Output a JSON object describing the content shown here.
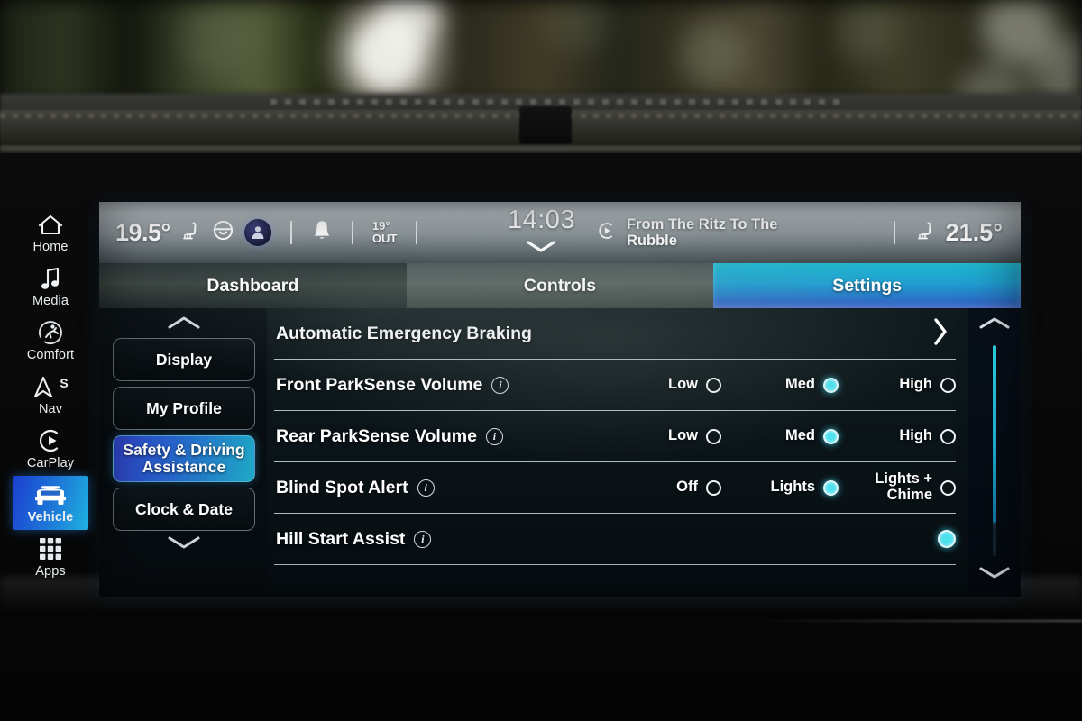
{
  "status_bar": {
    "driver_temp": "19.5°",
    "heated_seat_icon": "heated-seat-icon",
    "heated_wheel_icon": "heated-steering-wheel-icon",
    "profile_icon": "driver-profile-icon",
    "notification_icon": "bell-icon",
    "outside_temp_value": "19°",
    "outside_temp_label": "OUT",
    "clock": "14:03",
    "media_source_icon": "media-play-icon",
    "now_playing": "From The Ritz To The Rubble",
    "passenger_seat_icon": "heated-seat-icon",
    "passenger_temp": "21.5°"
  },
  "tabs": [
    {
      "label": "Dashboard",
      "active": false
    },
    {
      "label": "Controls",
      "active": false
    },
    {
      "label": "Settings",
      "active": true
    }
  ],
  "settings_menu": {
    "scroll_up_icon": "chevron-up-icon",
    "scroll_down_icon": "chevron-down-icon",
    "items": [
      {
        "label": "Display",
        "selected": false
      },
      {
        "label": "My Profile",
        "selected": false
      },
      {
        "label": "Safety & Driving Assistance",
        "selected": true
      },
      {
        "label": "Clock & Date",
        "selected": false
      }
    ]
  },
  "settings_rows": [
    {
      "label": "Automatic Emergency Braking",
      "has_info": false,
      "type": "submenu",
      "chevron_icon": "chevron-right-icon",
      "options": []
    },
    {
      "label": "Front ParkSense Volume",
      "has_info": true,
      "type": "radio-group",
      "options": [
        {
          "label": "Low",
          "selected": false
        },
        {
          "label": "Med",
          "selected": true
        },
        {
          "label": "High",
          "selected": false
        }
      ]
    },
    {
      "label": "Rear ParkSense Volume",
      "has_info": true,
      "type": "radio-group",
      "options": [
        {
          "label": "Low",
          "selected": false
        },
        {
          "label": "Med",
          "selected": true
        },
        {
          "label": "High",
          "selected": false
        }
      ]
    },
    {
      "label": "Blind Spot Alert",
      "has_info": true,
      "type": "radio-group",
      "options": [
        {
          "label": "Off",
          "selected": false
        },
        {
          "label": "Lights",
          "selected": true
        },
        {
          "label": "Lights + Chime",
          "selected": false
        }
      ]
    },
    {
      "label": "Hill Start Assist",
      "has_info": true,
      "type": "toggle",
      "options": [
        {
          "label": "",
          "selected": true
        }
      ]
    }
  ],
  "scrollbar": {
    "up_icon": "chevron-up-icon",
    "down_icon": "chevron-down-icon",
    "thumb_position_percent": 0
  },
  "sidebar": [
    {
      "label": "Home",
      "icon": "home-icon",
      "active": false
    },
    {
      "label": "Media",
      "icon": "music-note-icon",
      "active": false
    },
    {
      "label": "Comfort",
      "icon": "comfort-icon",
      "active": false
    },
    {
      "label": "Nav",
      "icon": "navigation-arrow-icon",
      "badge": "S",
      "active": false
    },
    {
      "label": "CarPlay",
      "icon": "carplay-icon",
      "active": false
    },
    {
      "label": "Vehicle",
      "icon": "vehicle-icon",
      "active": true
    },
    {
      "label": "Apps",
      "icon": "apps-grid-icon",
      "active": false
    }
  ],
  "colors": {
    "accent_cyan": "#2BC4DC",
    "accent_blue": "#2F58C2",
    "selected_tab_gradient_start": "#1DB5CD",
    "selected_tab_gradient_end": "#2F58C2",
    "text_primary": "#FFFFFF"
  }
}
